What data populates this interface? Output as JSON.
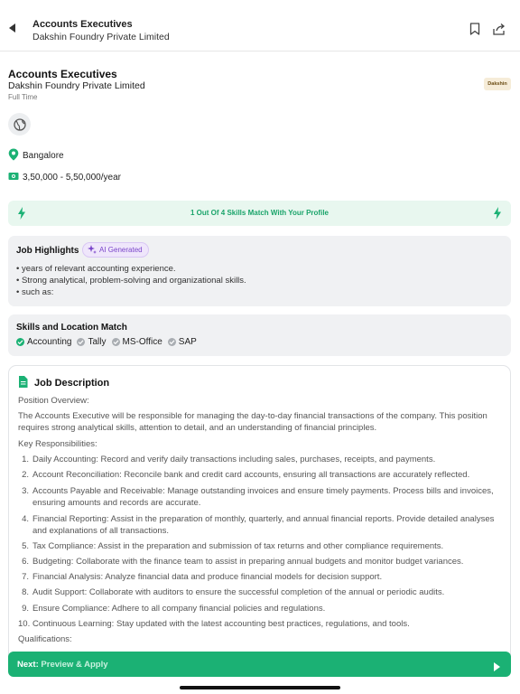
{
  "header": {
    "title": "Accounts Executives",
    "subtitle": "Dakshin Foundry Private Limited",
    "back_icon": "back-arrow-icon",
    "bookmark_icon": "bookmark-icon",
    "share_icon": "share-icon"
  },
  "job": {
    "title": "Accounts Executives",
    "company": "Dakshin Foundry Private Limited",
    "employment_type": "Full Time",
    "logo_text": "Dakshin",
    "location": "Bangalore",
    "salary": "3,50,000 - 5,50,000/year"
  },
  "match": {
    "text": "1 Out Of 4 Skills Match With Your Profile"
  },
  "highlights": {
    "title": "Job Highlights",
    "ai_badge": "AI Generated",
    "items": [
      "• years of relevant accounting experience.",
      "• Strong analytical, problem-solving and organizational skills.",
      "• such as:"
    ]
  },
  "skills": {
    "title": "Skills and Location Match",
    "items": [
      {
        "label": "Accounting",
        "matched": true
      },
      {
        "label": "Tally",
        "matched": false
      },
      {
        "label": "MS-Office",
        "matched": false
      },
      {
        "label": "SAP",
        "matched": false
      }
    ]
  },
  "description": {
    "title": "Job Description",
    "overview_label": "Position Overview:",
    "overview_text": "The Accounts Executive will be responsible for managing the day-to-day financial transactions of the company. This position requires strong analytical skills, attention to detail, and an understanding of financial principles.",
    "responsibilities_label": "Key Responsibilities:",
    "responsibilities": [
      {
        "num": "1.",
        "text": "Daily Accounting: Record and verify daily transactions including sales, purchases, receipts, and payments."
      },
      {
        "num": "2.",
        "text": "Account Reconciliation: Reconcile bank and credit card accounts, ensuring all transactions are accurately reflected."
      },
      {
        "num": "3.",
        "text": "Accounts Payable and Receivable: Manage outstanding invoices and ensure timely payments. Process bills and invoices, ensuring amounts and records are accurate."
      },
      {
        "num": "4.",
        "text": "Financial Reporting: Assist in the preparation of monthly, quarterly, and annual financial reports. Provide detailed analyses and explanations of all transactions."
      },
      {
        "num": "5.",
        "text": "Tax Compliance: Assist in the preparation and submission of tax returns and other compliance requirements."
      },
      {
        "num": "6.",
        "text": "Budgeting: Collaborate with the finance team to assist in preparing annual budgets and monitor budget variances."
      },
      {
        "num": "7.",
        "text": "Financial Analysis: Analyze financial data and produce financial models for decision support."
      },
      {
        "num": "8.",
        "text": "Audit Support: Collaborate with auditors to ensure the successful completion of the annual or periodic audits."
      },
      {
        "num": "9.",
        "text": "Ensure Compliance: Adhere to all company financial policies and regulations."
      },
      {
        "num": "10.",
        "text": "Continuous Learning: Stay updated with the latest accounting best practices, regulations, and tools."
      }
    ],
    "qualifications_label": "Qualifications:"
  },
  "footer": {
    "next_label": "Next:",
    "next_action": "Preview & Apply"
  },
  "colors": {
    "accent_green": "#1bb174",
    "match_bg": "#e8f7ef",
    "ai_purple": "#7a45c9"
  }
}
